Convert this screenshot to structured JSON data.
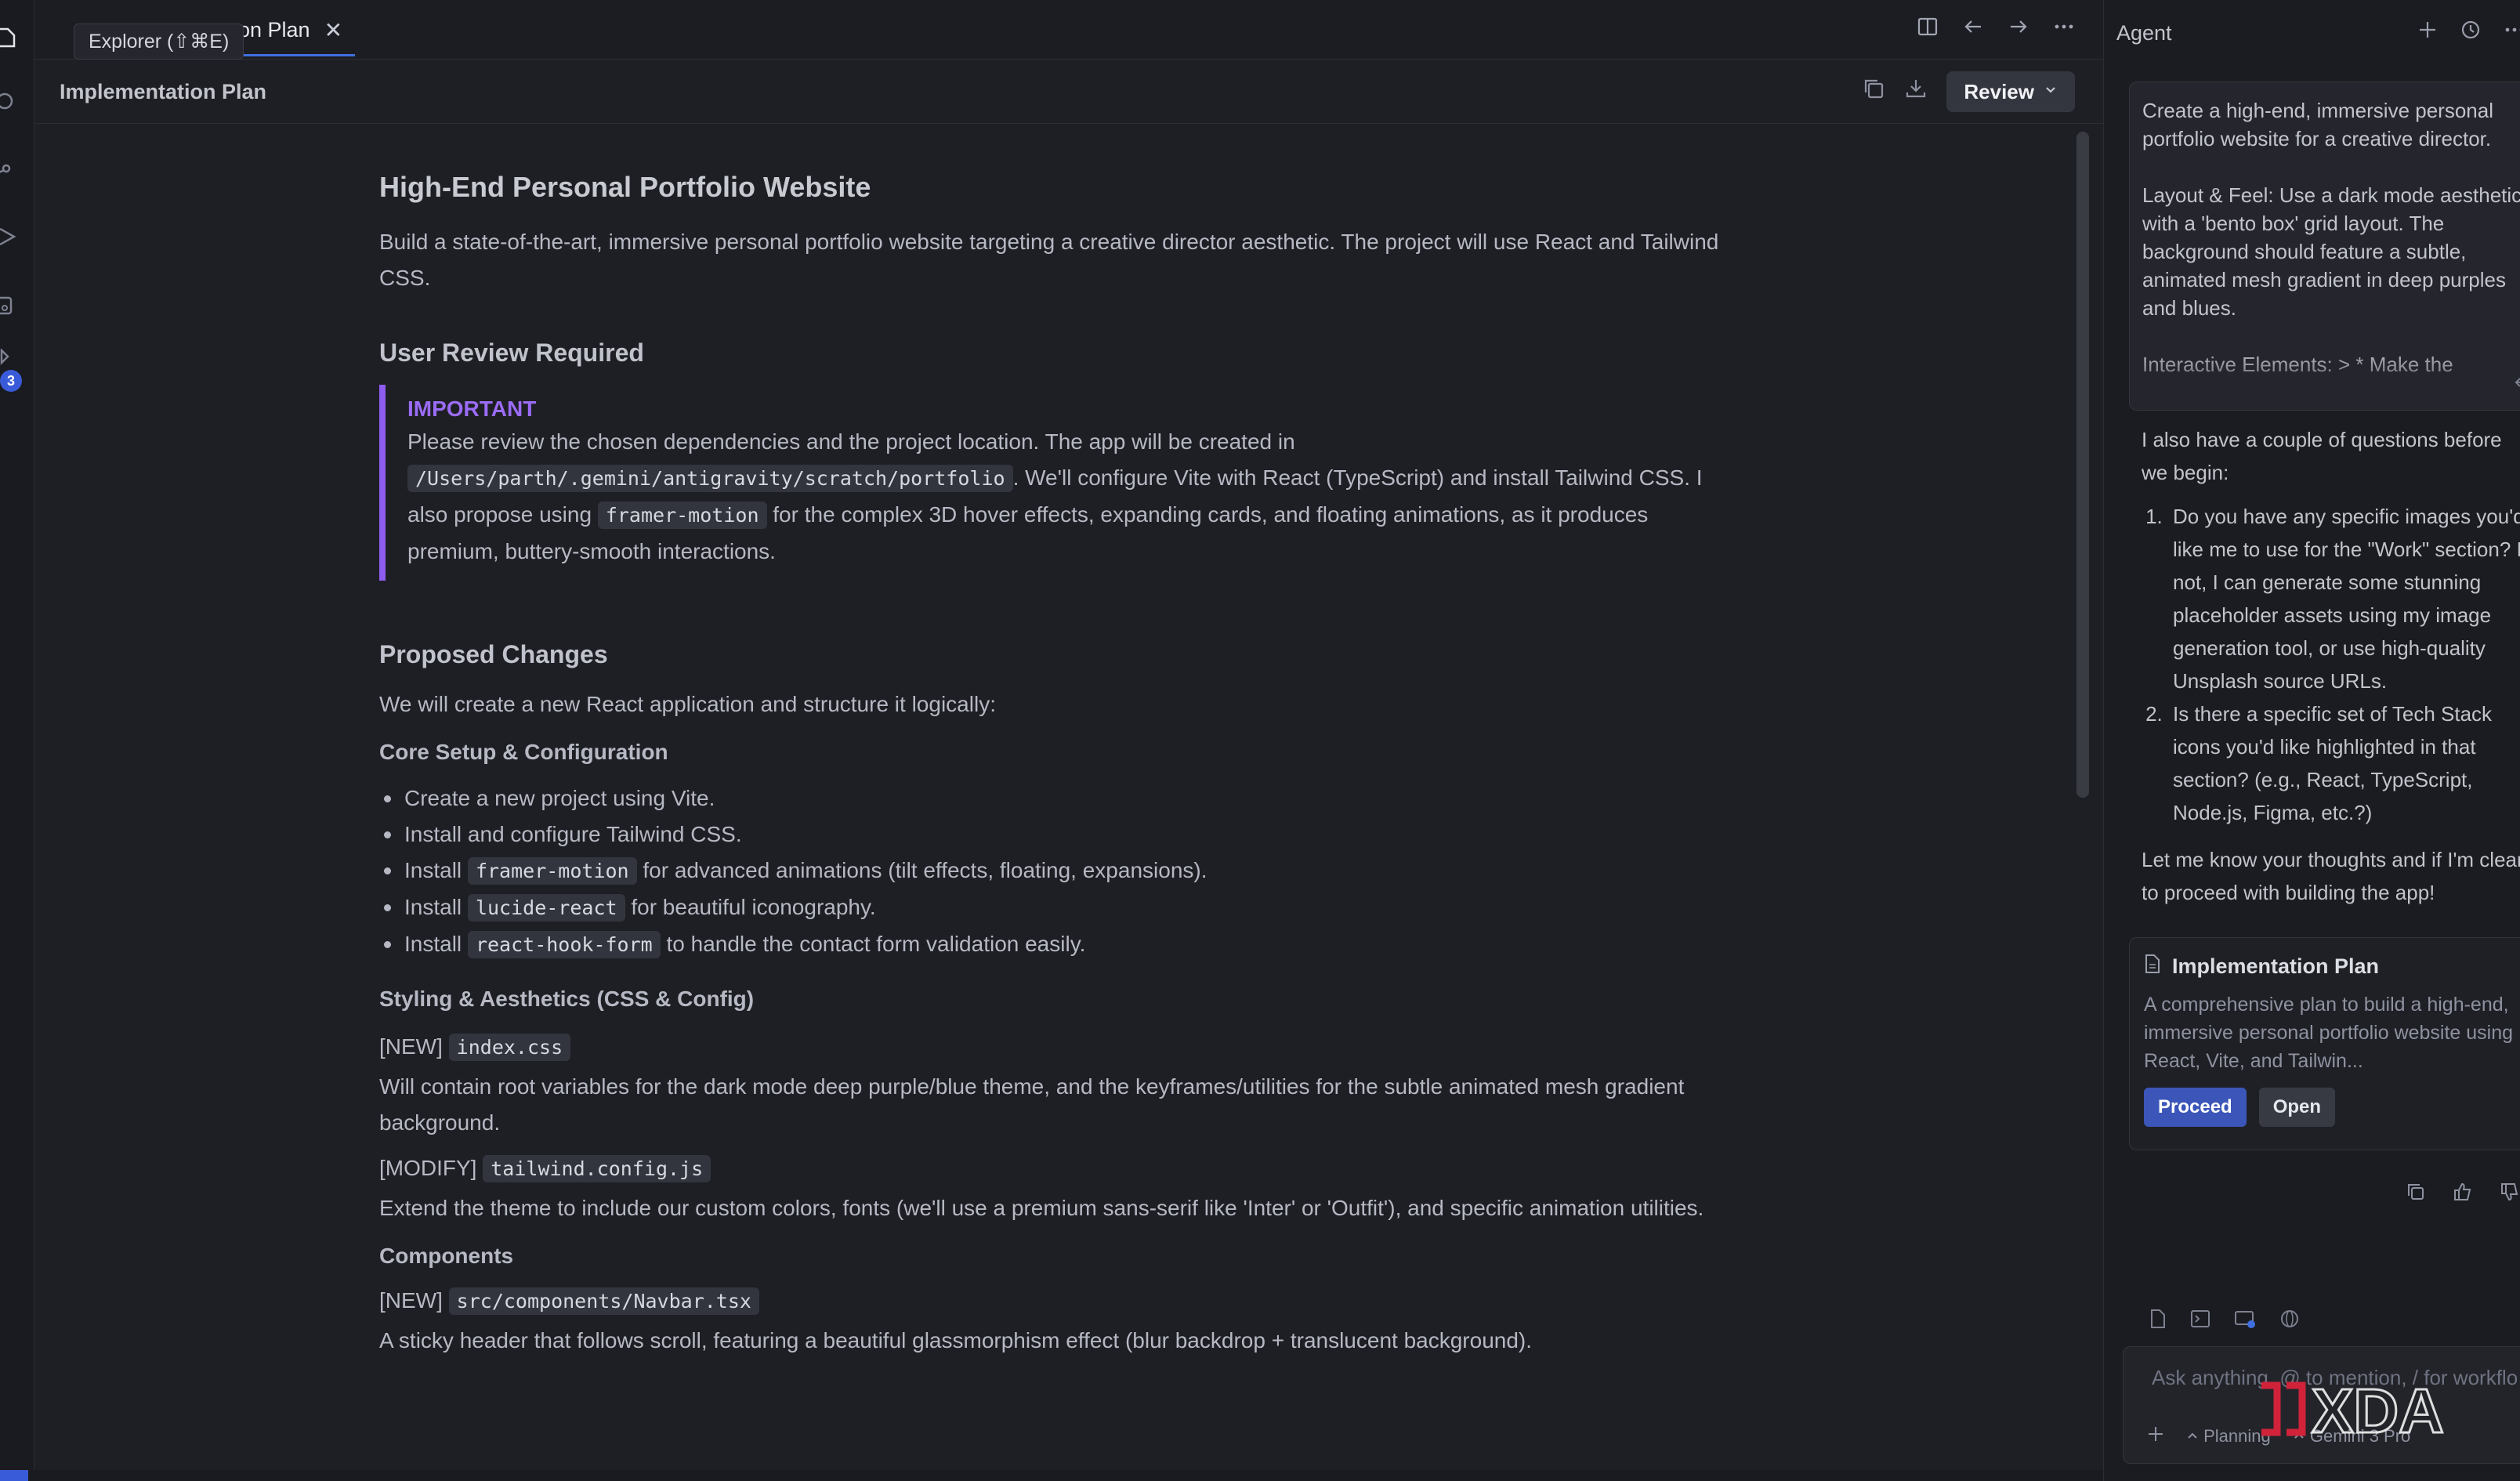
{
  "activity_bar": {
    "icons": [
      "files-icon",
      "search-icon",
      "source-control-icon",
      "run-debug-icon",
      "remote-icon",
      "extensions-icon"
    ],
    "badge": "3"
  },
  "tabbar": {
    "tooltip": "Explorer (⇧⌘E)",
    "active_tab": "on Plan",
    "close_glyph": "✕"
  },
  "doc": {
    "header_title": "Implementation Plan",
    "review_label": "Review",
    "title": "High-End Personal Portfolio Website",
    "intro": "Build a state-of-the-art, immersive personal portfolio website targeting a creative director aesthetic. The project will use React and Tailwind CSS.",
    "review_heading": "User Review Required",
    "important_label": "IMPORTANT",
    "important": {
      "p1": "Please review the chosen dependencies and the project location. The app will be created in",
      "path": "/Users/parth/.gemini/antigravity/scratch/portfolio",
      "p2": ". We'll configure Vite with React (TypeScript) and install Tailwind CSS. I also propose using",
      "code": "framer-motion",
      "p3": "for the complex 3D hover effects, expanding cards, and floating animations, as it produces premium, buttery-smooth interactions."
    },
    "proposed_heading": "Proposed Changes",
    "proposed_intro": "We will create a new React application and structure it logically:",
    "core_heading": "Core Setup & Configuration",
    "bullets": [
      {
        "pre": "Create a new project using Vite.",
        "code": "",
        "post": ""
      },
      {
        "pre": "Install and configure Tailwind CSS.",
        "code": "",
        "post": ""
      },
      {
        "pre": "Install",
        "code": "framer-motion",
        "post": "for advanced animations (tilt effects, floating, expansions)."
      },
      {
        "pre": "Install",
        "code": "lucide-react",
        "post": "for beautiful iconography."
      },
      {
        "pre": "Install",
        "code": "react-hook-form",
        "post": "to handle the contact form validation easily."
      }
    ],
    "styling_heading": "Styling & Aesthetics (CSS & Config)",
    "file1": {
      "tag": "[NEW]",
      "code": "index.css",
      "desc": "Will contain root variables for the dark mode deep purple/blue theme, and the keyframes/utilities for the subtle animated mesh gradient background."
    },
    "file2": {
      "tag": "[MODIFY]",
      "code": "tailwind.config.js",
      "desc": "Extend the theme to include our custom colors, fonts (we'll use a premium sans-serif like 'Inter' or 'Outfit'), and specific animation utilities."
    },
    "components_heading": "Components",
    "file3": {
      "tag": "[NEW]",
      "code": "src/components/Navbar.tsx",
      "desc": "A sticky header that follows scroll, featuring a beautiful glassmorphism effect (blur backdrop + translucent background)."
    }
  },
  "agent": {
    "title": "Agent",
    "prompt": "Create a high-end, immersive personal portfolio website for a creative director.\n\nLayout & Feel: Use a dark mode aesthetic with a 'bento box' grid layout. The background should feature a subtle, animated mesh gradient in deep purples and blues.\n\nInteractive Elements: > * Make the",
    "reply_intro": "I also have a couple of questions before we begin:",
    "questions": [
      "Do you have any specific images you'd like me to use for the \"Work\" section? If not, I can generate some stunning placeholder assets using my image generation tool, or use high-quality Unsplash source URLs.",
      "Is there a specific set of Tech Stack icons you'd like highlighted in that section? (e.g., React, TypeScript, Node.js, Figma, etc.?)"
    ],
    "reply_closing": "Let me know your thoughts and if I'm clear to proceed with building the app!",
    "plan_card": {
      "title": "Implementation Plan",
      "desc": "A comprehensive plan to build a high-end, immersive personal portfolio website using React, Vite, and Tailwin...",
      "proceed": "Proceed",
      "open": "Open"
    },
    "input_placeholder": "Ask anything, @ to mention, / for workflo",
    "mode_label": "Planning",
    "model_label": "Gemini 3 Pro",
    "watermark": "XDA"
  },
  "colors": {
    "accent": "#3f6fe0",
    "important": "#9b6cf7",
    "proceed": "#3b56b8"
  }
}
